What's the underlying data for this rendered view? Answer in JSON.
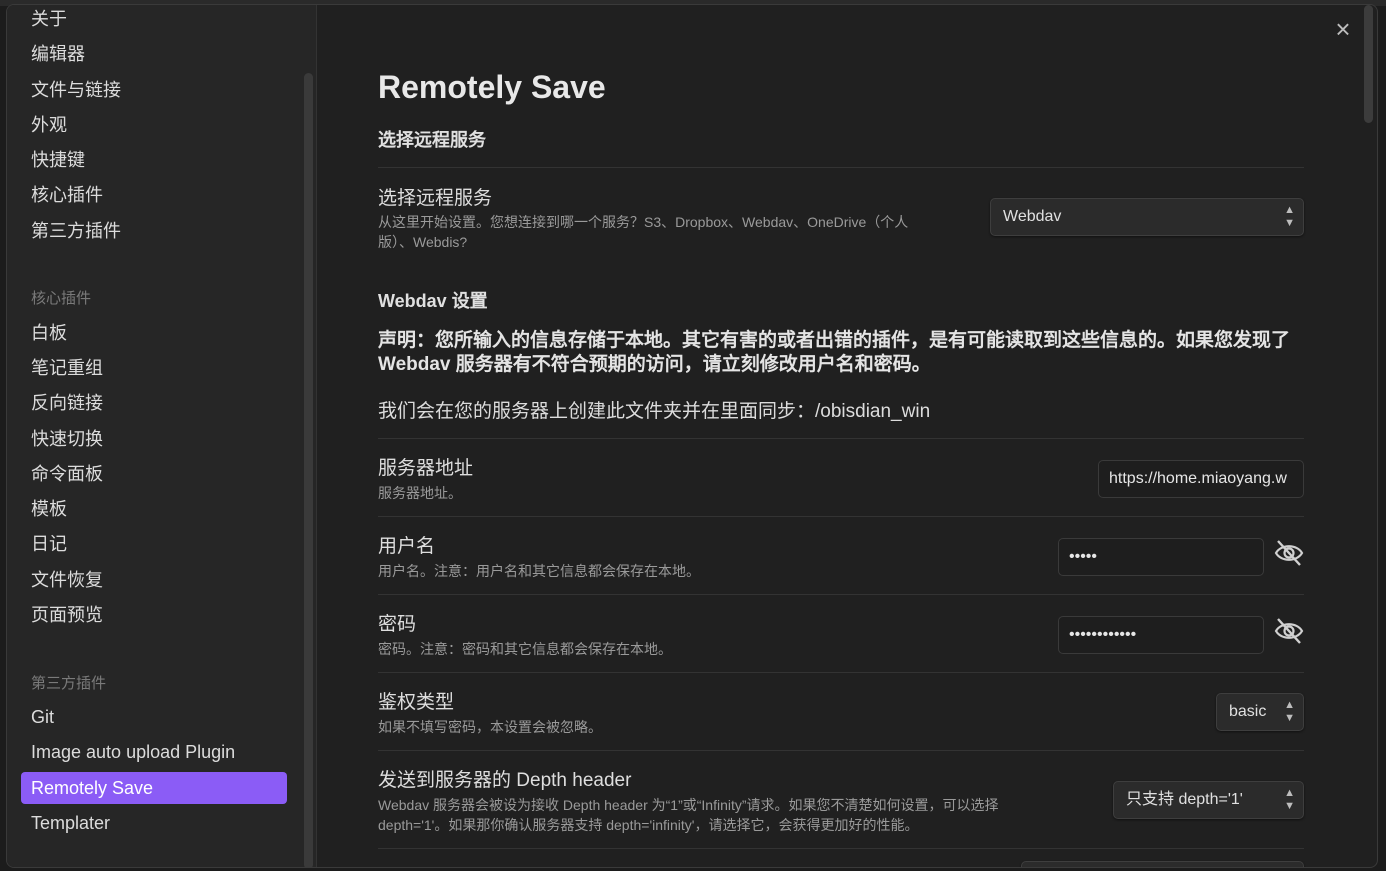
{
  "sidebar": {
    "top_items": [
      {
        "label": "关于"
      },
      {
        "label": "编辑器"
      },
      {
        "label": "文件与链接"
      },
      {
        "label": "外观"
      },
      {
        "label": "快捷键"
      },
      {
        "label": "核心插件"
      },
      {
        "label": "第三方插件"
      }
    ],
    "core_heading": "核心插件",
    "core_items": [
      {
        "label": "白板"
      },
      {
        "label": "笔记重组"
      },
      {
        "label": "反向链接"
      },
      {
        "label": "快速切换"
      },
      {
        "label": "命令面板"
      },
      {
        "label": "模板"
      },
      {
        "label": "日记"
      },
      {
        "label": "文件恢复"
      },
      {
        "label": "页面预览"
      }
    ],
    "third_heading": "第三方插件",
    "third_items": [
      {
        "label": "Git"
      },
      {
        "label": "Image auto upload Plugin"
      },
      {
        "label": "Remotely Save"
      },
      {
        "label": "Templater"
      }
    ]
  },
  "close_icon": "×",
  "page": {
    "title": "Remotely Save",
    "remote_section": "选择远程服务",
    "remote_setting": {
      "name": "选择远程服务",
      "desc_line1": "从这里开始设置。您想连接到哪一个服务？S3、Dropbox、Webdav、OneDrive（个人",
      "desc_line2": "版）、Webdis?",
      "value": "Webdav"
    },
    "webdav_section": "Webdav 设置",
    "notice_line1": "声明：您所输入的信息存储于本地。其它有害的或者出错的插件，是有可能读取到这些信息的。如果您发现了",
    "notice_line2": "Webdav 服务器有不符合预期的访问，请立刻修改用户名和密码。",
    "sync_folder": "我们会在您的服务器上创建此文件夹并在里面同步：/obisdian_win",
    "server": {
      "name": "服务器地址",
      "desc": "服务器地址。",
      "value": "https://home.miaoyang.w"
    },
    "username": {
      "name": "用户名",
      "desc": "用户名。注意：用户名和其它信息都会保存在本地。",
      "value": "•••••"
    },
    "password": {
      "name": "密码",
      "desc": "密码。注意：密码和其它信息都会保存在本地。",
      "value": "••••••••••••"
    },
    "auth": {
      "name": "鉴权类型",
      "desc": "如果不填写密码，本设置会被忽略。",
      "value": "basic"
    },
    "depth": {
      "name": "发送到服务器的 Depth header",
      "desc_line1": "Webdav 服务器会被设为接收 Depth header 为“1”或“Infinity”请求。如果您不清楚如何设置，可以选择",
      "desc_line2": "depth='1'。如果那你确认服务器支持 depth='infinity'，请选择它，会获得更加好的性能。",
      "value": "只支持 depth='1'"
    }
  },
  "colors": {
    "accent": "#8b5cf6",
    "background": "#202020",
    "sidebar": "#262626"
  }
}
